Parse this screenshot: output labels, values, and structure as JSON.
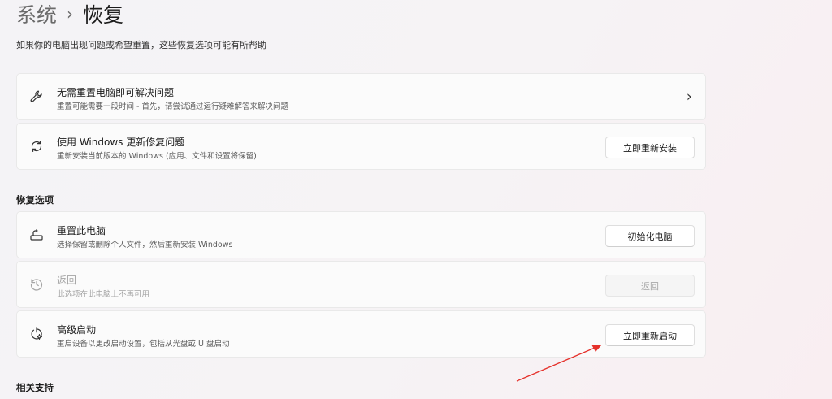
{
  "breadcrumb": {
    "parent": "系统",
    "separator": "›",
    "current": "恢复"
  },
  "page_description": "如果你的电脑出现问题或希望重置，这些恢复选项可能有所帮助",
  "top_cards": [
    {
      "title": "无需重置电脑即可解决问题",
      "subtitle": "重置可能需要一段时间 - 首先，请尝试通过运行疑难解答来解决问题",
      "icon": "wrench-icon",
      "chevron": "›"
    },
    {
      "title": "使用 Windows 更新修复问题",
      "subtitle": "重新安装当前版本的 Windows (应用、文件和设置将保留)",
      "icon": "refresh-icon",
      "button": "立即重新安装"
    }
  ],
  "recovery_options": {
    "header": "恢复选项",
    "items": [
      {
        "title": "重置此电脑",
        "subtitle": "选择保留或删除个人文件，然后重新安装 Windows",
        "icon": "reset-pc-icon",
        "button": "初始化电脑",
        "enabled": true
      },
      {
        "title": "返回",
        "subtitle": "此选项在此电脑上不再可用",
        "icon": "history-icon",
        "button": "返回",
        "enabled": false
      },
      {
        "title": "高级启动",
        "subtitle": "重启设备以更改启动设置，包括从光盘或 U 盘启动",
        "icon": "advanced-startup-icon",
        "button": "立即重新启动",
        "enabled": true
      }
    ]
  },
  "related_support": {
    "header": "相关支持"
  },
  "colors": {
    "annotation_arrow": "#e5312b",
    "disabled_text": "#a4a4a4",
    "card_bg": "#fbfbfb"
  }
}
